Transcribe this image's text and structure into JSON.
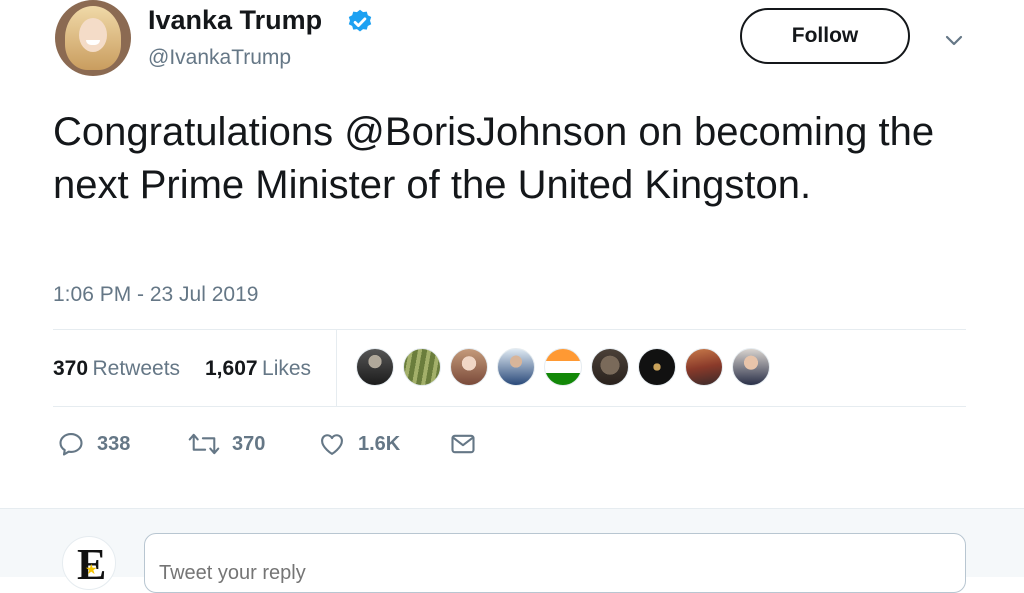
{
  "header": {
    "name": "Ivanka Trump",
    "handle": "@IvankaTrump",
    "follow_label": "Follow"
  },
  "tweet": {
    "text": "Congratulations @BorisJohnson on becoming the next Prime Minister of the United Kingston.",
    "timestamp": "1:06 PM - 23 Jul 2019"
  },
  "stats": {
    "retweets_count": "370",
    "retweets_label": "Retweets",
    "likes_count": "1,607",
    "likes_label": "Likes"
  },
  "actions": {
    "replies": "338",
    "retweets": "370",
    "likes": "1.6K"
  },
  "reply": {
    "placeholder": "Tweet your reply"
  },
  "colors": {
    "verified_blue": "#1da1f2",
    "text_primary": "#14171a",
    "text_secondary": "#657786"
  }
}
